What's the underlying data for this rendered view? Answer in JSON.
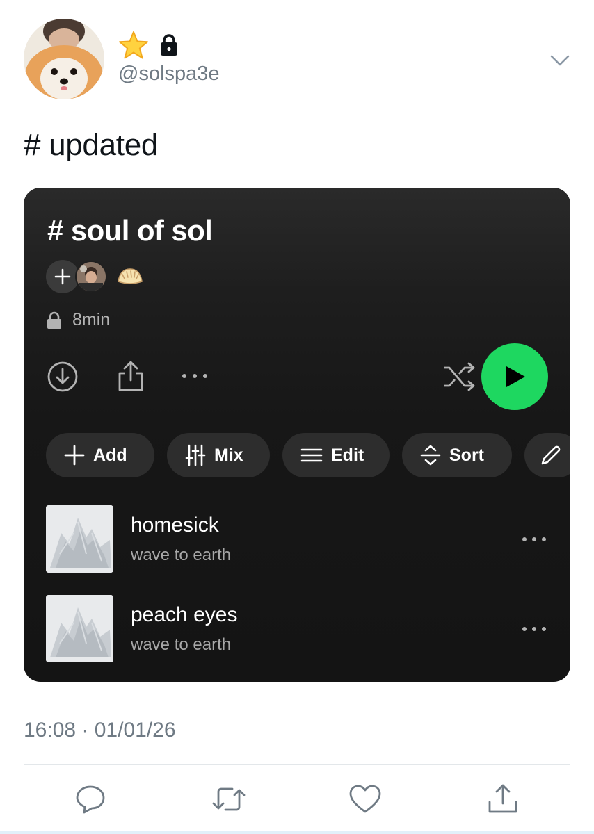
{
  "tweet": {
    "handle": "@solspa3e",
    "name_icons": [
      "star-icon",
      "lock-icon"
    ],
    "text": "# updated",
    "timestamp": "16:08 · 01/01/26"
  },
  "playlist": {
    "title": "# soul of sol",
    "collaborators": [
      "avatar",
      "dumpling-emoji"
    ],
    "duration": "8min",
    "visibility_icon": "lock-icon",
    "accent_color": "#1ed760",
    "chips": [
      {
        "label": "Add",
        "icon": "plus-icon"
      },
      {
        "label": "Mix",
        "icon": "sliders-icon"
      },
      {
        "label": "Edit",
        "icon": "list-icon"
      },
      {
        "label": "Sort",
        "icon": "sort-icon"
      },
      {
        "label": "",
        "icon": "pencil-icon"
      }
    ],
    "tracks": [
      {
        "name": "homesick",
        "artist": "wave to earth"
      },
      {
        "name": "peach eyes",
        "artist": "wave to earth"
      }
    ]
  },
  "footer_actions": [
    "reply-icon",
    "retweet-icon",
    "like-icon",
    "share-icon"
  ]
}
